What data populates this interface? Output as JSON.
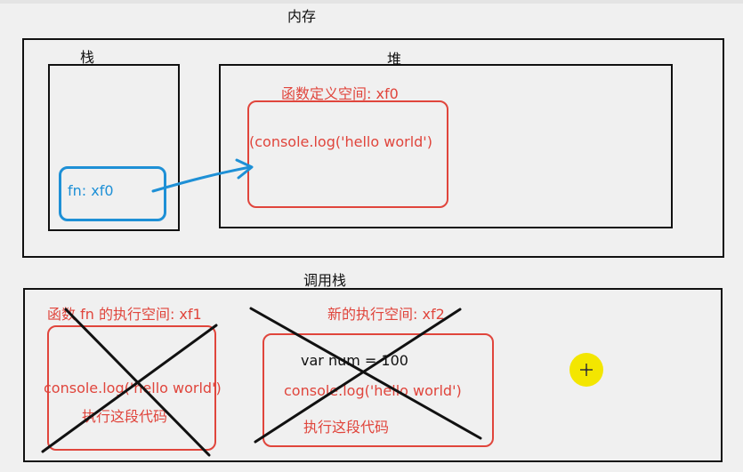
{
  "memory": {
    "title": "内存",
    "stack": {
      "title": "栈",
      "var_label": "fn: xf0"
    },
    "heap": {
      "title": "堆",
      "def_space_label": "函数定义空间:  xf0",
      "code": "(console.log('hello world')"
    }
  },
  "call_stack": {
    "title": "调用栈",
    "frame1": {
      "label": "函数 fn 的执行空间: xf1",
      "code": "console.log('hello world')",
      "desc": "执行这段代码"
    },
    "frame2": {
      "label": "新的执行空间: xf2",
      "var_line": "var num = 100",
      "code": "console.log('hello world')",
      "desc": "执行这段代码"
    }
  },
  "colors": {
    "red": "#e0453c",
    "blue": "#1e90d6",
    "black": "#111111",
    "cursor": "#f3e600"
  },
  "icons": {
    "arrow": "arrow-icon",
    "cross": "cross-out-icon",
    "cursor": "mouse-cursor-icon"
  }
}
